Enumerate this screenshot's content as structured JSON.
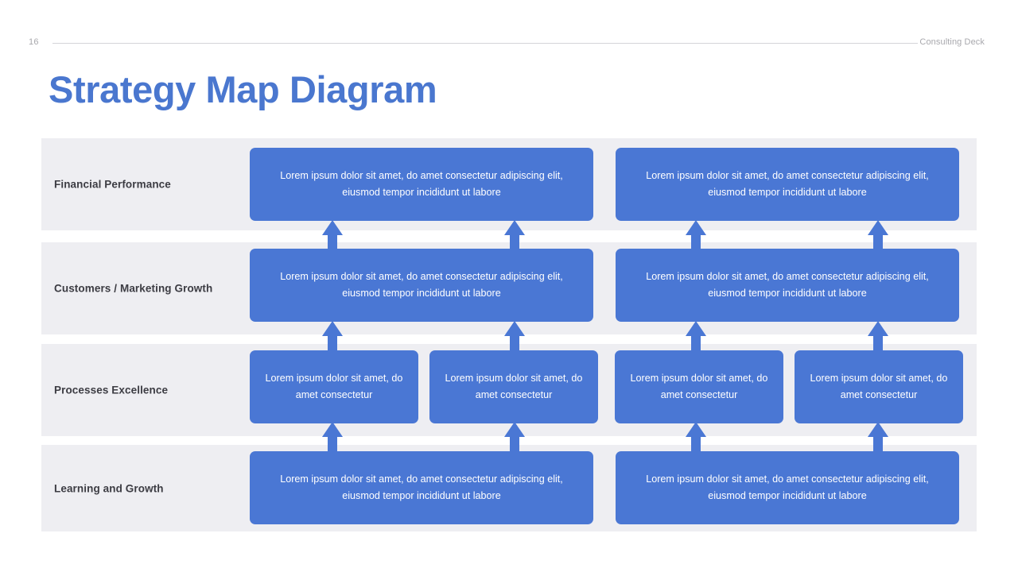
{
  "header": {
    "page_number": "16",
    "deck_label": "Consulting Deck"
  },
  "title": "Strategy Map Diagram",
  "colors": {
    "title_blue": "#4a77cf",
    "card_blue": "#4a77d4",
    "band_gray": "#eeeef2",
    "label_text": "#3c3c43",
    "header_text": "#a8a8ad"
  },
  "text_variants": {
    "long": "Lorem ipsum dolor sit amet, do amet consectetur adipiscing elit, eiusmod tempor incididunt ut labore",
    "short": "Lorem ipsum dolor sit amet, do amet consectetur"
  },
  "rows": [
    {
      "label": "Financial Performance",
      "cards": [
        {
          "text": "Lorem ipsum dolor sit amet, do amet consectetur adipiscing elit, eiusmod tempor incididunt ut labore"
        },
        {
          "text": "Lorem ipsum dolor sit amet, do amet consectetur adipiscing elit, eiusmod tempor incididunt ut labore"
        }
      ]
    },
    {
      "label": "Customers / Marketing Growth",
      "cards": [
        {
          "text": "Lorem ipsum dolor sit amet, do amet consectetur adipiscing elit, eiusmod tempor incididunt ut labore"
        },
        {
          "text": "Lorem ipsum dolor sit amet, do amet consectetur adipiscing elit, eiusmod tempor incididunt ut labore"
        }
      ]
    },
    {
      "label": "Processes Excellence",
      "cards": [
        {
          "text": "Lorem ipsum dolor sit amet, do amet consectetur"
        },
        {
          "text": "Lorem ipsum dolor sit amet, do amet consectetur"
        },
        {
          "text": "Lorem ipsum dolor sit amet, do amet consectetur"
        },
        {
          "text": "Lorem ipsum dolor sit amet, do amet consectetur"
        }
      ]
    },
    {
      "label": "Learning and Growth",
      "cards": [
        {
          "text": "Lorem ipsum dolor sit amet, do amet consectetur adipiscing elit, eiusmod tempor incididunt ut labore"
        },
        {
          "text": "Lorem ipsum dolor sit amet, do amet consectetur adipiscing elit, eiusmod tempor incididunt ut labore"
        }
      ]
    }
  ],
  "connector_count": 12
}
